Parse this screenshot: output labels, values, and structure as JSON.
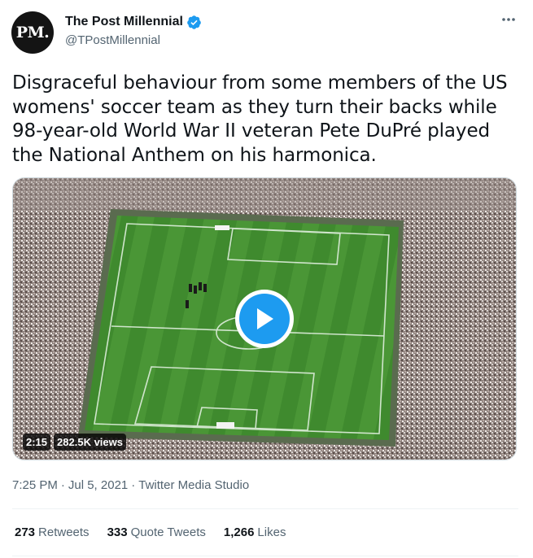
{
  "author": {
    "avatar_text": "PM.",
    "display_name": "The Post Millennial",
    "handle": "@TPostMillennial",
    "verified": true
  },
  "tweet": {
    "text": "Disgraceful behaviour from some members of the US womens' soccer team as they turn their backs while 98-year-old World War II veteran Pete DuPré played the National Anthem on his harmonica.",
    "time": "7:25 PM",
    "separator": "·",
    "date": "Jul 5, 2021",
    "source": "Twitter Media Studio"
  },
  "video": {
    "duration": "2:15",
    "views": "282.5K views"
  },
  "stats": {
    "retweets_count": "273",
    "retweets_label": "Retweets",
    "quotes_count": "333",
    "quotes_label": "Quote Tweets",
    "likes_count": "1,266",
    "likes_label": "Likes"
  },
  "colors": {
    "accent": "#1d9bf0",
    "text": "#0f1419",
    "secondary": "#536471",
    "pitch": "#3f8a2e"
  },
  "icons": [
    "verified-badge-icon",
    "more-options-icon",
    "play-icon"
  ]
}
